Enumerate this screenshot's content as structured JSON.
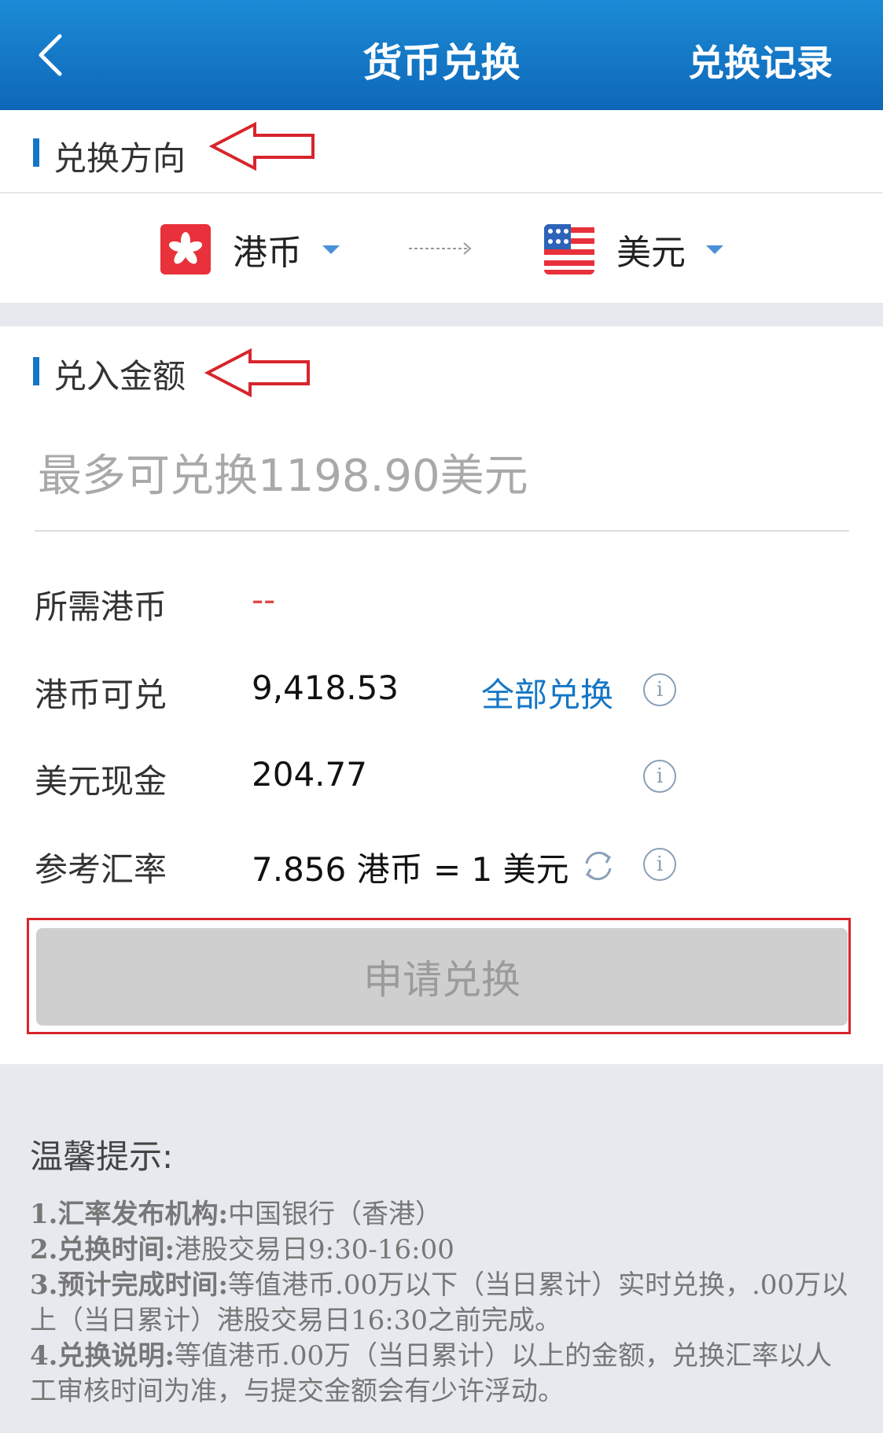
{
  "header": {
    "title": "货币兑换",
    "record_label": "兑换记录"
  },
  "direction": {
    "title": "兑换方向",
    "from": {
      "name": "港币",
      "icon": "hong-kong-flag-icon"
    },
    "to": {
      "name": "美元",
      "icon": "us-flag-icon"
    }
  },
  "amount": {
    "title": "兑入金额",
    "placeholder": "最多可兑换1198.90美元"
  },
  "rows": {
    "required": {
      "label": "所需港币",
      "value": "--"
    },
    "available": {
      "label": "港币可兑",
      "value": "9,418.53",
      "action": "全部兑换"
    },
    "cash": {
      "label": "美元现金",
      "value": "204.77"
    },
    "rate": {
      "label": "参考汇率",
      "value": "7.856 港币 = 1 美元"
    }
  },
  "apply_button": "申请兑换",
  "tips": {
    "title": "温馨提示:",
    "items": [
      {
        "label": "1.汇率发布机构:",
        "text": "中国银行（香港）"
      },
      {
        "label": "2.兑换时间:",
        "text": "港股交易日9:30-16:00"
      },
      {
        "label": "3.预计完成时间:",
        "text": "等值港币.00万以下（当日累计）实时兑换，.00万以上（当日累计）港股交易日16:30之前完成。"
      },
      {
        "label": "4.兑换说明:",
        "text": "等值港币.00万（当日累计）以上的金额，兑换汇率以人工审核时间为准，与提交金额会有少许浮动。"
      }
    ]
  },
  "colors": {
    "header_blue": "#1476c6",
    "link_blue": "#1476c6",
    "dash_red": "#e04747",
    "annotation_red": "#d7252c"
  }
}
